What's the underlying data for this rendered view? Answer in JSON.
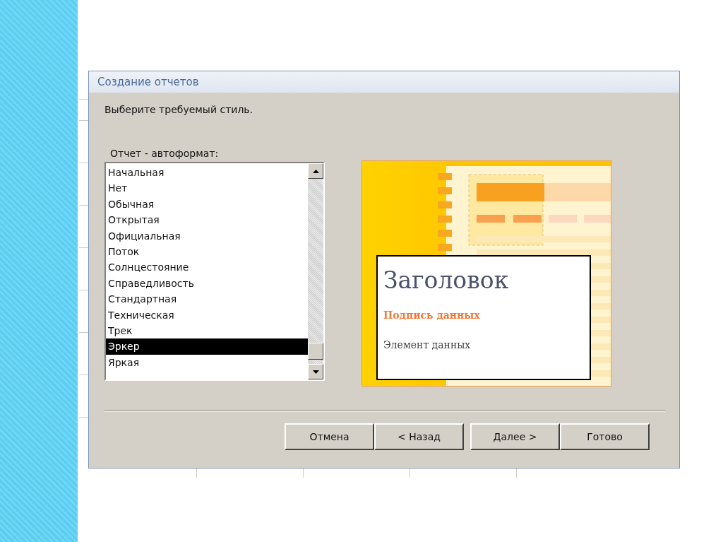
{
  "window": {
    "title": "Создание отчетов"
  },
  "instruction": "Выберите требуемый стиль.",
  "style_list": {
    "label": "Отчет - автоформат:",
    "items": [
      {
        "label": "Начальная",
        "selected": false
      },
      {
        "label": "Нет",
        "selected": false
      },
      {
        "label": "Обычная",
        "selected": false
      },
      {
        "label": "Открытая",
        "selected": false
      },
      {
        "label": "Официальная",
        "selected": false
      },
      {
        "label": "Поток",
        "selected": false
      },
      {
        "label": "Солнцестояние",
        "selected": false
      },
      {
        "label": "Справедливость",
        "selected": false
      },
      {
        "label": "Стандартная",
        "selected": false
      },
      {
        "label": "Техническая",
        "selected": false
      },
      {
        "label": "Трек",
        "selected": false
      },
      {
        "label": "Эркер",
        "selected": true
      },
      {
        "label": "Яркая",
        "selected": false
      }
    ]
  },
  "preview": {
    "title": "Заголовок",
    "caption": "Подпись данных",
    "item": "Элемент данных"
  },
  "buttons": [
    "Отмена",
    "< Назад",
    "Далее >",
    "Готово"
  ]
}
